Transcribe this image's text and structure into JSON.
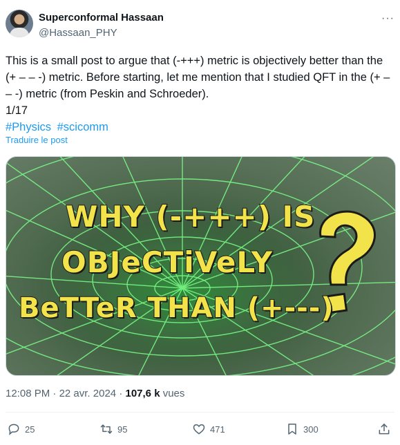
{
  "author": {
    "name": "Superconformal Hassaan",
    "handle": "@Hassaan_PHY"
  },
  "more_label": "···",
  "post": {
    "text_line1": "This is a small post to argue that (-+++) metric is objectively better than the (+ – – -) metric. Before starting, let me mention that I studied QFT in the (+ – – -) metric (from Peskin and Schroeder).",
    "counter": "1/17",
    "hashtags": [
      "#Physics",
      "#scicomm"
    ],
    "translate_label": "Traduire le post"
  },
  "image": {
    "line1": "WHY (-+++) IS",
    "line2": "OBJeCTiVeLY",
    "line3": "BeTTeR THAN (+---)",
    "accent_color": "#f3e34a"
  },
  "meta": {
    "time": "12:08 PM",
    "sep": "·",
    "date": "22 avr. 2024",
    "views_count": "107,6 k",
    "views_label": "vues"
  },
  "actions": {
    "replies": "25",
    "reposts": "95",
    "likes": "471",
    "bookmarks": "300"
  }
}
